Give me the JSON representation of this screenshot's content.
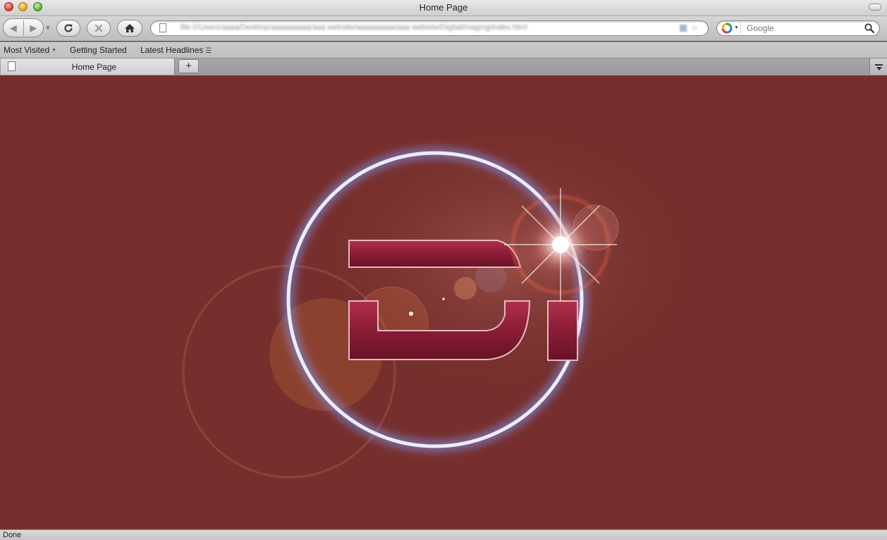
{
  "window": {
    "title": "Home Page"
  },
  "toolbar": {
    "back_icon": "back-arrow-icon",
    "forward_icon": "forward-arrow-icon",
    "reload_icon": "reload-icon",
    "stop_icon": "stop-icon",
    "home_icon": "home-icon",
    "search_placeholder": "Google"
  },
  "bookmarks": {
    "items": [
      {
        "label": "Most Visited"
      },
      {
        "label": "Getting Started"
      },
      {
        "label": "Latest Headlines"
      }
    ]
  },
  "tabs": [
    {
      "label": "Home Page",
      "active": true
    }
  ],
  "newtab_label": "+",
  "content": {
    "background": "#762f2c",
    "logo": {
      "description_letters": "DI",
      "ring_color": "#7f9cff",
      "letter_color": "#8c1e34"
    }
  },
  "status": {
    "text": "Done"
  }
}
